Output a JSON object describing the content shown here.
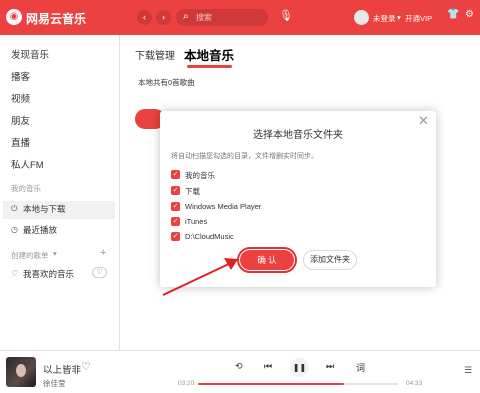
{
  "colors": {
    "accent": "#ec4141",
    "sidebar_active_bg": "#f1f1f1"
  },
  "titlebar": {
    "app_name": "网易云音乐",
    "logo_icon": "netease-logo",
    "back_icon": "chevron-left-icon",
    "forward_icon": "chevron-right-icon",
    "search_placeholder": "搜索",
    "login_text": "未登录",
    "vip_text": "开通VIP"
  },
  "sidebar": {
    "top_items": [
      {
        "label": "发现音乐"
      },
      {
        "label": "播客"
      },
      {
        "label": "视频"
      },
      {
        "label": "朋友"
      },
      {
        "label": "直播"
      },
      {
        "label": "私人FM"
      }
    ],
    "my_music_label": "我的音乐",
    "my_items": [
      {
        "label": "本地与下载",
        "icon": "download-icon"
      },
      {
        "label": "最近播放",
        "icon": "clock-icon"
      }
    ],
    "created_label": "创建的歌单",
    "playlists": [
      {
        "label": "我喜欢的音乐",
        "icon": "heart-icon"
      }
    ]
  },
  "main": {
    "tabs": [
      {
        "label": "下载管理"
      },
      {
        "label": "本地音乐"
      }
    ],
    "song_count_text": "本地共有0首歌曲"
  },
  "dialog": {
    "title": "选择本地音乐文件夹",
    "description": "将自动扫描您勾选的目录，文件增删实时同步。",
    "folders": [
      {
        "label": "我的音乐",
        "checked": true
      },
      {
        "label": "下载",
        "checked": true
      },
      {
        "label": "Windows Media Player",
        "checked": true
      },
      {
        "label": "iTunes",
        "checked": true
      },
      {
        "label": "D:\\CloudMusic",
        "checked": true
      }
    ],
    "confirm_label": "确 认",
    "add_folder_label": "添加文件夹"
  },
  "player": {
    "song_title": "以上皆非",
    "artist": "徐佳莹",
    "time_current": "03:20",
    "time_total": "04:33",
    "progress": 0.73,
    "lyrics_label": "词"
  }
}
